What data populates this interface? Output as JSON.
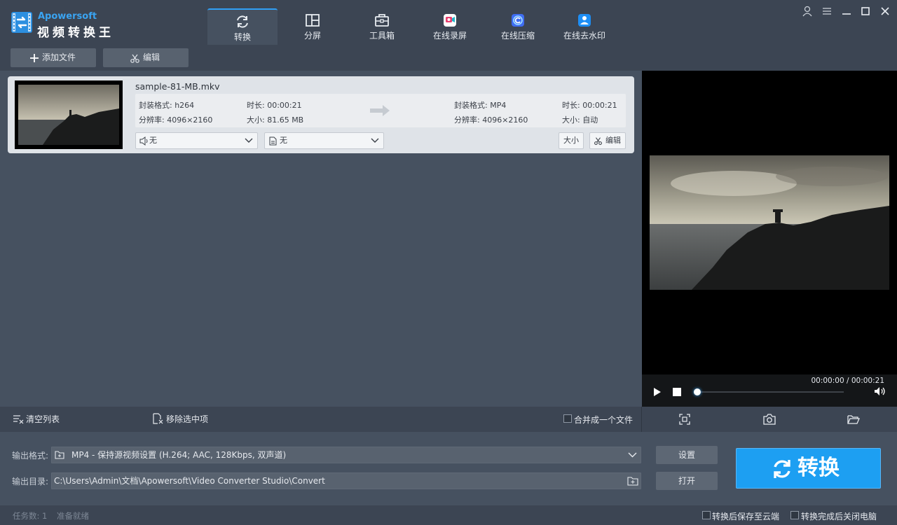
{
  "app": {
    "brand": "Apowersoft",
    "name": "视频转换王"
  },
  "nav": {
    "tabs": [
      {
        "label": "转换",
        "icon": "refresh-icon",
        "active": true
      },
      {
        "label": "分屏",
        "icon": "split-screen-icon"
      },
      {
        "label": "工具箱",
        "icon": "toolbox-icon"
      },
      {
        "label": "在线录屏",
        "icon": "screen-record-icon"
      },
      {
        "label": "在线压缩",
        "icon": "compress-icon"
      },
      {
        "label": "在线去水印",
        "icon": "watermark-remove-icon"
      }
    ]
  },
  "window_controls": [
    "user-icon",
    "menu-icon",
    "minimize-icon",
    "maximize-icon",
    "close-icon"
  ],
  "toolbar": {
    "add_file": "添加文件",
    "edit": "编辑"
  },
  "file": {
    "name": "sample-81-MB.mkv",
    "source": {
      "format": "封装格式: h264",
      "duration": "时长: 00:00:21",
      "resolution": "分辨率: 4096×2160",
      "size": "大小: 81.65 MB"
    },
    "target": {
      "format": "封装格式: MP4",
      "duration": "时长: 00:00:21",
      "resolution": "分辨率: 4096×2160",
      "size": "大小: 自动"
    },
    "audio_select": "无",
    "subtitle_select": "无",
    "size_button": "大小",
    "edit_button": "编辑"
  },
  "player": {
    "time": "00:00:00 / 00:00:21",
    "progress": 0
  },
  "actions": {
    "clear_list": "清空列表",
    "remove_selected": "移除选中项",
    "merge_label": "合并成一个文件"
  },
  "output": {
    "format_label": "输出格式:",
    "format_value": "MP4 - 保持源视频设置 (H.264; AAC, 128Kbps, 双声道)",
    "dir_label": "输出目录:",
    "dir_value": "C:\\Users\\Admin\\文档\\Apowersoft\\Video Converter Studio\\Convert",
    "settings_button": "设置",
    "open_button": "打开",
    "convert_button": "转换"
  },
  "status": {
    "task_count": "任务数: 1",
    "state": "准备就绪",
    "save_cloud": "转换后保存至云端",
    "shutdown": "转换完成后关闭电脑"
  },
  "colors": {
    "accent": "#1d9ff2",
    "bg": "#465160",
    "bar": "#3c4553"
  }
}
